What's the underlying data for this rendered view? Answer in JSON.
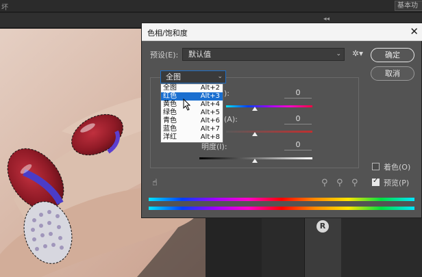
{
  "app": {
    "top_left_text": "坏",
    "workspace_label": "基本功",
    "panel_collapse_glyph": "◂◂"
  },
  "dialog": {
    "title": "色相/饱和度",
    "close_glyph": "✕",
    "preset_label": "预设(E):",
    "preset_value": "默认值",
    "ok_label": "确定",
    "cancel_label": "取消",
    "range_value": "全图",
    "dropdown_items": [
      {
        "label": "全图",
        "shortcut": "Alt+2",
        "selected": false
      },
      {
        "label": "红色",
        "shortcut": "Alt+3",
        "selected": true
      },
      {
        "label": "黄色",
        "shortcut": "Alt+4",
        "selected": false
      },
      {
        "label": "绿色",
        "shortcut": "Alt+5",
        "selected": false
      },
      {
        "label": "青色",
        "shortcut": "Alt+6",
        "selected": false
      },
      {
        "label": "蓝色",
        "shortcut": "Alt+7",
        "selected": false
      },
      {
        "label": "洋红",
        "shortcut": "Alt+8",
        "selected": false
      }
    ],
    "hue": {
      "label_partial": "):",
      "value": "0"
    },
    "saturation": {
      "label_partial": "(A):",
      "value": "0"
    },
    "lightness": {
      "label": "明度(I):",
      "value": "0"
    },
    "colorize_label": "着色(O)",
    "colorize_checked": false,
    "preview_label": "预览(P)",
    "preview_checked": true
  },
  "icons": {
    "hand": "targeted-adjust-icon",
    "dropper": "eyedropper-icon",
    "dropper_plus": "eyedropper-add-icon",
    "dropper_minus": "eyedropper-subtract-icon",
    "gear": "gear-icon",
    "library": "cc-libraries-icon"
  }
}
